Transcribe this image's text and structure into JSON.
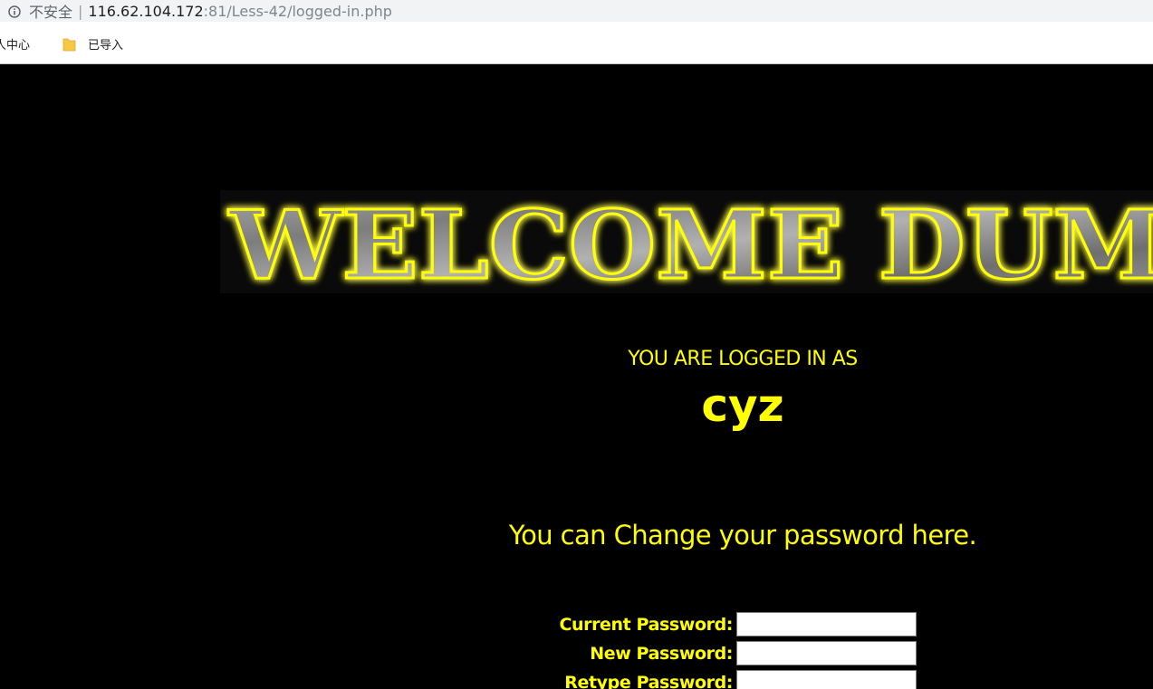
{
  "browser": {
    "security_label": "不安全",
    "separator": "|",
    "url_host": "116.62.104.172",
    "url_rest": ":81/Less-42/logged-in.php",
    "bookmarks": [
      {
        "label": "人中心"
      },
      {
        "label": "已导入"
      }
    ]
  },
  "page": {
    "banner_text": "WELCOME DUM",
    "logged_in_label": "YOU ARE LOGGED IN AS",
    "username": "cyz",
    "change_password_text": "You can Change your password here.",
    "form": {
      "current_password_label": "Current Password:",
      "new_password_label": "New Password:",
      "retype_password_label": "Retype Password:",
      "current_password_value": "",
      "new_password_value": "",
      "retype_password_value": ""
    }
  },
  "colors": {
    "page_background": "#000000",
    "text_accent": "#ffff00",
    "banner_glow": "#ffff00",
    "banner_fill": "#8a8a8a"
  }
}
